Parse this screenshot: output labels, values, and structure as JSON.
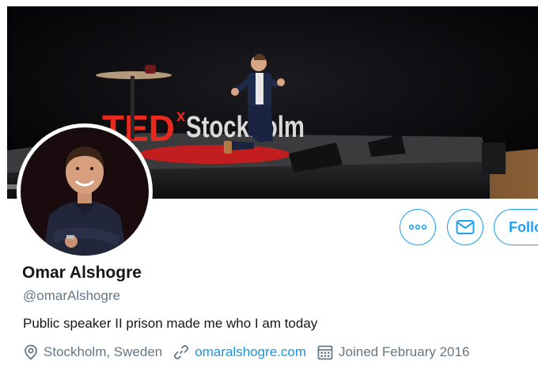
{
  "profile": {
    "display_name": "Omar Alshogre",
    "handle": "@omarAlshogre",
    "bio": "Public speaker II prison made me who I am today",
    "location": "Stockholm, Sweden",
    "website": "omaralshogre.com",
    "joined": "Joined February 2016"
  },
  "banner": {
    "stage_sign_ted": "TED",
    "stage_sign_x": "x",
    "stage_sign_city": "Stockholm"
  },
  "actions": {
    "follow_label": "Follow",
    "more_icon": "more-dots-icon",
    "message_icon": "envelope-icon"
  },
  "icons": {
    "location": "location-pin-icon",
    "link": "link-icon",
    "calendar": "calendar-icon"
  },
  "colors": {
    "accent": "#1da1f2",
    "link": "#1b95e0",
    "secondary_text": "#657786",
    "primary_text": "#14171a",
    "ted_red": "#e62b1e"
  }
}
